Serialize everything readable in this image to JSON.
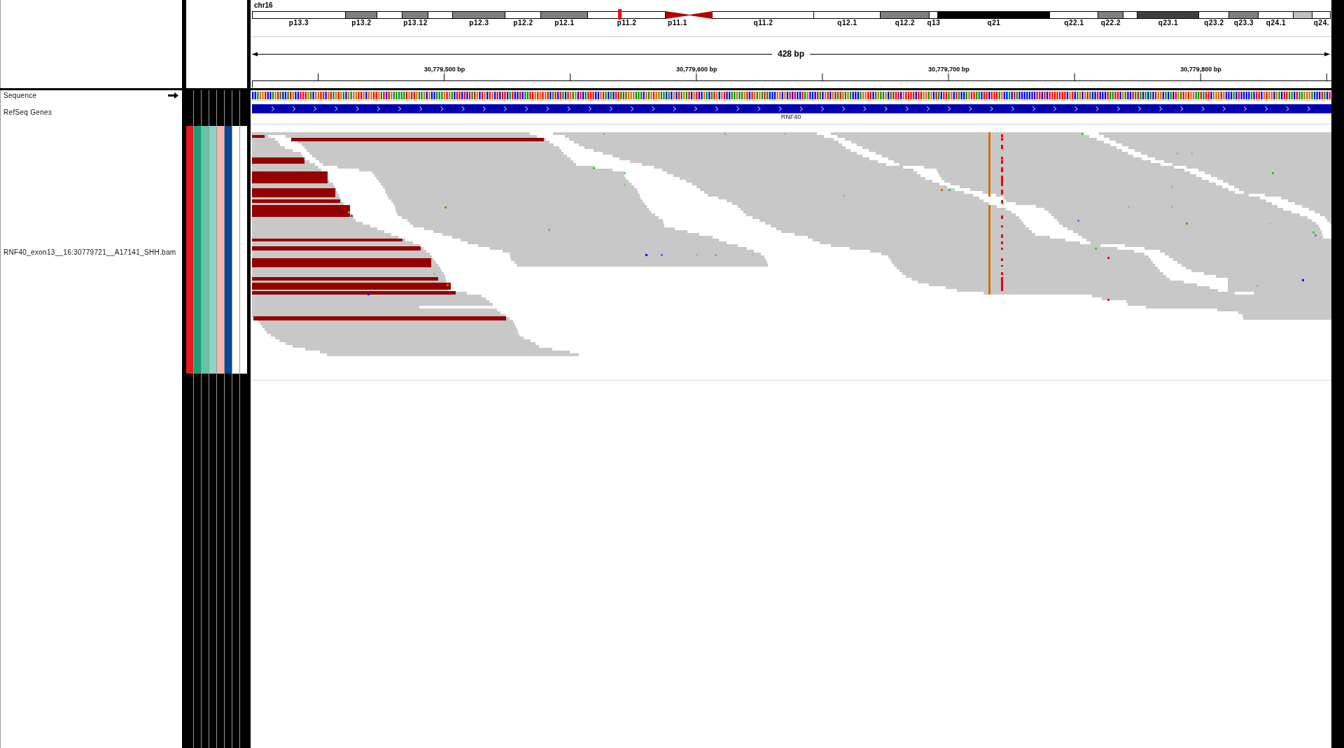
{
  "ideogram": {
    "chromosome": "chr16",
    "bands": [
      {
        "label": "p13.3",
        "kind": "band",
        "color": "#ffffff",
        "current": false
      },
      {
        "label": "p13.2",
        "kind": "band",
        "color": "#808080",
        "current": false
      },
      {
        "kind": "band",
        "color": "#ffffff",
        "current": false
      },
      {
        "label": "p13.12",
        "kind": "band",
        "color": "#808080",
        "current": false
      },
      {
        "kind": "band",
        "color": "#ffffff",
        "current": false
      },
      {
        "label": "p12.3",
        "kind": "band",
        "color": "#808080",
        "current": false
      },
      {
        "label": "p12.2",
        "kind": "band",
        "color": "#ffffff",
        "current": false
      },
      {
        "label": "p12.1",
        "kind": "band",
        "color": "#808080",
        "current": false
      },
      {
        "label": "p11.2",
        "kind": "band",
        "color": "#ffffff",
        "current": true
      },
      {
        "label": "p11.1",
        "kind": "centromere",
        "color": "#b40000",
        "current": false
      },
      {
        "kind": "centromere",
        "color": "#b40000",
        "current": false
      },
      {
        "label": "q11.2",
        "kind": "band",
        "color": "#ffffff",
        "current": false
      },
      {
        "label": "q12.1",
        "kind": "band",
        "color": "#ffffff",
        "current": false
      },
      {
        "label": "q12.2",
        "kind": "band",
        "color": "#808080",
        "current": false
      },
      {
        "label": "q13",
        "kind": "band",
        "color": "#ffffff",
        "current": false
      },
      {
        "label": "q21",
        "kind": "band",
        "color": "#000000",
        "current": false
      },
      {
        "label": "q22.1",
        "kind": "band",
        "color": "#ffffff",
        "current": false
      },
      {
        "label": "q22.2",
        "kind": "band",
        "color": "#808080",
        "current": false
      },
      {
        "kind": "band",
        "color": "#ffffff",
        "current": false
      },
      {
        "label": "q23.1",
        "kind": "band",
        "color": "#404040",
        "current": false
      },
      {
        "label": "q23.2",
        "kind": "band",
        "color": "#ffffff",
        "current": false
      },
      {
        "label": "q23.3",
        "kind": "band",
        "color": "#808080",
        "current": false
      },
      {
        "label": "q24.1",
        "kind": "band",
        "color": "#ffffff",
        "current": false
      },
      {
        "kind": "band",
        "color": "#c0c0c0",
        "current": false
      },
      {
        "label": "q24.",
        "kind": "band",
        "color": "#ffffff",
        "current": false
      }
    ]
  },
  "ruler": {
    "span": "428 bp",
    "ticks": [
      "30,779,500 bp",
      "30,779,600 bp",
      "30,779,700 bp",
      "30,779,800 bp"
    ]
  },
  "tracks": [
    {
      "kind": "sequence",
      "name": "Sequence",
      "forward": true
    },
    {
      "kind": "genes",
      "name": "RefSeq Genes",
      "features": [
        {
          "name": "RNF40",
          "forward": true
        }
      ]
    },
    {
      "kind": "alignments",
      "name": "RNF40_exon13__16:30779721__A17141_SHH.bam",
      "attributes": [
        {
          "color": "#e41a1c"
        },
        {
          "color": "#1b9e77"
        },
        {
          "color": "#66c2a5"
        },
        {
          "color": "#8dd3c7"
        },
        {
          "color": "#fbb4ae"
        },
        {
          "color": "#08479a"
        },
        {
          "color": "#ffffff"
        },
        {
          "color": "#ffffff"
        }
      ]
    }
  ]
}
